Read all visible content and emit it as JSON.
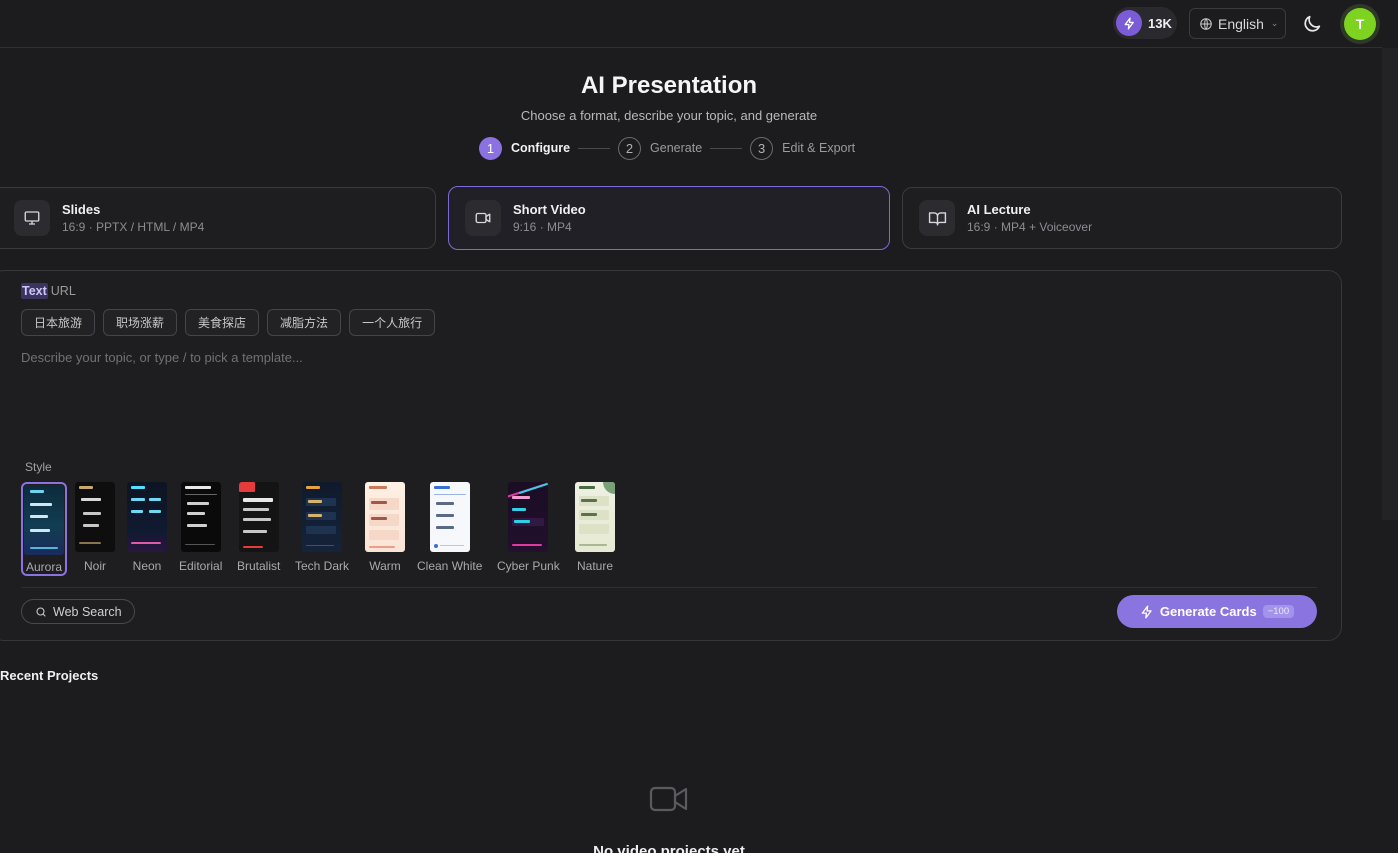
{
  "topbar": {
    "credits": "13K",
    "language": "English",
    "avatar_initial": "T"
  },
  "header": {
    "title": "AI Presentation",
    "subtitle": "Choose a format, describe your topic, and generate",
    "steps": [
      {
        "num": "1",
        "label": "Configure"
      },
      {
        "num": "2",
        "label": "Generate"
      },
      {
        "num": "3",
        "label": "Edit & Export"
      }
    ]
  },
  "formats": [
    {
      "name": "Slides",
      "sub": "16:9 · PPTX / HTML / MP4"
    },
    {
      "name": "Short Video",
      "sub": "9:16 · MP4"
    },
    {
      "name": "AI Lecture",
      "sub": "16:9 · MP4 + Voiceover"
    }
  ],
  "composer": {
    "mode_text": "Text",
    "mode_url": "URL",
    "chips": [
      "日本旅游",
      "职场涨薪",
      "美食探店",
      "减脂方法",
      "一个人旅行"
    ],
    "placeholder": "Describe your topic, or type / to pick a template...",
    "style_label": "Style",
    "styles": [
      "Aurora",
      "Noir",
      "Neon",
      "Editorial",
      "Brutalist",
      "Tech Dark",
      "Warm",
      "Clean White",
      "Cyber Punk",
      "Nature"
    ],
    "selected_style": "Aurora",
    "web_search": "Web Search",
    "generate_label": "Generate Cards",
    "generate_cost": "−100"
  },
  "recent": {
    "title": "Recent Projects",
    "empty_text": "No video projects yet"
  },
  "colors": {
    "accent": "#8a75e0",
    "avatar": "#7ed321",
    "background": "#1c1c1e"
  }
}
